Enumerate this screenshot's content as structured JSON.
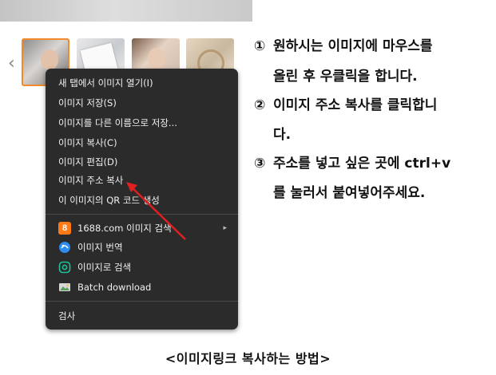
{
  "menu": {
    "items": [
      "새 탭에서 이미지 열기(I)",
      "이미지 저장(S)",
      "이미지를 다른 이름으로 저장...",
      "이미지 복사(C)",
      "이미지 편집(D)",
      "이미지 주소 복사",
      "이 이미지의 QR 코드 생성"
    ],
    "extensions": [
      {
        "label": "1688.com 이미지 검색",
        "icon": "1688-icon",
        "icon_text": "8",
        "submenu": "▸"
      },
      {
        "label": "이미지 번역",
        "icon": "translate-icon"
      },
      {
        "label": "이미지로 검색",
        "icon": "lens-icon"
      },
      {
        "label": "Batch download",
        "icon": "batch-download-icon"
      }
    ],
    "inspect": "검사"
  },
  "gallery": {
    "prev_arrow": "‹"
  },
  "instructions": [
    {
      "num": "①",
      "text": "원하시는 이미지에 마우스를"
    },
    {
      "num": "",
      "text": "올린 후 우클릭을 합니다."
    },
    {
      "num": "②",
      "text": "이미지 주소 복사를 클릭합니"
    },
    {
      "num": "",
      "text": "다."
    },
    {
      "num": "③",
      "text": "주소를 넣고 싶은 곳에 ctrl+v"
    },
    {
      "num": "",
      "text": "를 눌러서 붙여넣어주세요."
    }
  ],
  "caption": "<이미지링크 복사하는 방법>",
  "colors": {
    "menu_bg": "#2b2b2b",
    "menu_text": "#f0f0f0",
    "selected_thumb_border": "#f28a2c",
    "arrow": "#e02020"
  }
}
